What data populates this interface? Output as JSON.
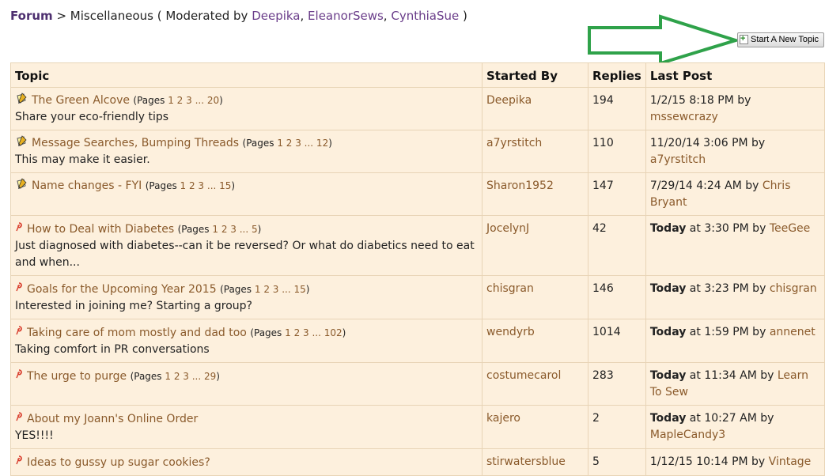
{
  "breadcrumb": {
    "forum": "Forum",
    "sep": ">",
    "section": "Miscellaneous",
    "moderated_by": "( Moderated by",
    "moderators": [
      "Deepika",
      "EleanorSews",
      "CynthiaSue"
    ],
    "close": ")"
  },
  "toolbar": {
    "new_topic_label": "Start A New Topic"
  },
  "table": {
    "headers": {
      "topic": "Topic",
      "started_by": "Started By",
      "replies": "Replies",
      "last_post": "Last Post"
    },
    "rows": [
      {
        "icon": "hot-topic-icon",
        "title": "The Green Alcove",
        "pages_label": "(Pages",
        "pages": "1 2 3 ... 20",
        "desc": "Share your eco-friendly tips",
        "starter": "Deepika",
        "replies": "194",
        "last_today": "",
        "last_time": "1/2/15 8:18 PM by",
        "last_user": "mssewcrazy"
      },
      {
        "icon": "hot-topic-icon",
        "title": "Message Searches, Bumping Threads",
        "pages_label": "(Pages",
        "pages": "1 2 3 ... 12",
        "desc": "This may make it easier.",
        "starter": "a7yrstitch",
        "replies": "110",
        "last_today": "",
        "last_time": "11/20/14 3:06 PM by",
        "last_user": "a7yrstitch"
      },
      {
        "icon": "hot-topic-icon",
        "title": "Name changes - FYI",
        "pages_label": "(Pages",
        "pages": "1 2 3 ... 15",
        "desc": "",
        "starter": "Sharon1952",
        "replies": "147",
        "last_today": "",
        "last_time": "7/29/14 4:24 AM by",
        "last_user": "Chris Bryant"
      },
      {
        "icon": "new-topic-icon",
        "title": "How to Deal with Diabetes",
        "pages_label": "(Pages",
        "pages": "1 2 3 ... 5",
        "desc": "Just diagnosed with diabetes--can it be reversed? Or what do diabetics need to eat and when...",
        "starter": "JocelynJ",
        "replies": "42",
        "last_today": "Today",
        "last_time": "at 3:30 PM by",
        "last_user": "TeeGee"
      },
      {
        "icon": "new-topic-icon",
        "title": "Goals for the Upcoming Year 2015",
        "pages_label": "(Pages",
        "pages": "1 2 3 ... 15",
        "desc": "Interested in joining me? Starting a group?",
        "starter": "chisgran",
        "replies": "146",
        "last_today": "Today",
        "last_time": "at 3:23 PM by",
        "last_user": "chisgran"
      },
      {
        "icon": "new-topic-icon",
        "title": "Taking care of mom mostly and dad too",
        "pages_label": "(Pages",
        "pages": "1 2 3 ... 102",
        "desc": "Taking comfort in PR conversations",
        "starter": "wendyrb",
        "replies": "1014",
        "last_today": "Today",
        "last_time": "at 1:59 PM by",
        "last_user": "annenet"
      },
      {
        "icon": "new-topic-icon",
        "title": "The urge to purge",
        "pages_label": "(Pages",
        "pages": "1 2 3 ... 29",
        "desc": "",
        "starter": "costumecarol",
        "replies": "283",
        "last_today": "Today",
        "last_time": "at 11:34 AM by",
        "last_user": "Learn To Sew"
      },
      {
        "icon": "new-topic-icon",
        "title": "About my Joann's Online Order",
        "pages_label": "",
        "pages": "",
        "desc": "YES!!!!",
        "starter": "kajero",
        "replies": "2",
        "last_today": "Today",
        "last_time": "at 10:27 AM by",
        "last_user": "MapleCandy3"
      },
      {
        "icon": "new-topic-icon",
        "title": "Ideas to gussy up sugar cookies?",
        "pages_label": "",
        "pages": "",
        "desc": "",
        "starter": "stirwatersblue",
        "replies": "5",
        "last_today": "",
        "last_time": "1/12/15 10:14 PM by",
        "last_user": "Vintage"
      }
    ]
  },
  "colors": {
    "link": "#8a5a2b",
    "row_bg": "#fdf0dd",
    "border": "#e8d4b6",
    "arrow": "#2fa24a",
    "forum": "#4d2f6f"
  }
}
